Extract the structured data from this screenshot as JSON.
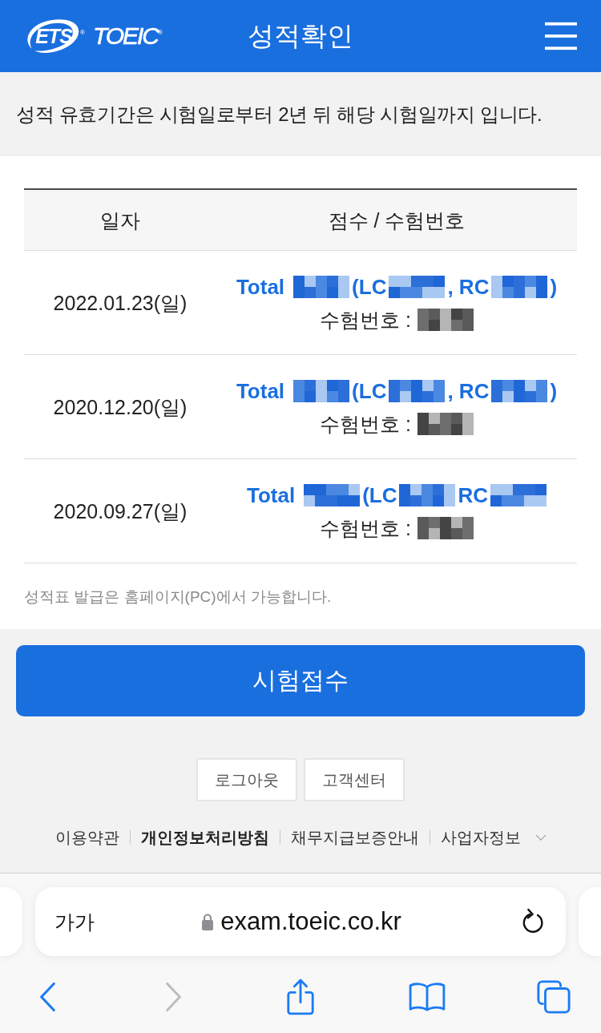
{
  "header": {
    "logo": {
      "ets": "ETS",
      "ets_mark": "®",
      "wordmark": "TOEIC",
      "wordmark_mark": "®"
    },
    "title": "성적확인"
  },
  "notice": "성적 유효기간은 시험일로부터 2년 뒤 해당 시험일까지 입니다.",
  "table": {
    "columns": [
      "일자",
      "점수 / 수험번호"
    ],
    "rows": [
      {
        "date": "2022.01.23(일)",
        "score": [
          {
            "kind": "text",
            "text": "Total"
          },
          {
            "kind": "redacted"
          },
          {
            "kind": "text",
            "text": "(LC"
          },
          {
            "kind": "redacted"
          },
          {
            "kind": "text",
            "text": ", RC"
          },
          {
            "kind": "redacted"
          },
          {
            "kind": "text",
            "text": ")"
          }
        ],
        "exam_no_label": "수험번호 :"
      },
      {
        "date": "2020.12.20(일)",
        "score": [
          {
            "kind": "text",
            "text": "Total"
          },
          {
            "kind": "redacted"
          },
          {
            "kind": "text",
            "text": "(LC"
          },
          {
            "kind": "redacted"
          },
          {
            "kind": "text",
            "text": ", RC"
          },
          {
            "kind": "redacted"
          },
          {
            "kind": "text",
            "text": ")"
          }
        ],
        "exam_no_label": "수험번호 :"
      },
      {
        "date": "2020.09.27(일)",
        "score": [
          {
            "kind": "text",
            "text": "Total"
          },
          {
            "kind": "redacted"
          },
          {
            "kind": "text",
            "text": "(LC"
          },
          {
            "kind": "redacted"
          },
          {
            "kind": "text",
            "text": "RC"
          },
          {
            "kind": "redacted"
          }
        ],
        "exam_no_label": "수험번호 :"
      }
    ]
  },
  "issue_note": "성적표 발급은 홈페이지(PC)에서 가능합니다.",
  "apply_button": "시험접수",
  "footer": {
    "buttons": [
      "로그아웃",
      "고객센터"
    ],
    "links": [
      {
        "text": "이용약관",
        "bold": false,
        "dropdown": false
      },
      {
        "text": "개인정보처리방침",
        "bold": true,
        "dropdown": false
      },
      {
        "text": "채무지급보증안내",
        "bold": false,
        "dropdown": false
      },
      {
        "text": "사업자정보",
        "bold": false,
        "dropdown": true
      }
    ]
  },
  "browser": {
    "text_size": "가가",
    "secure": true,
    "url": "exam.toeic.co.kr",
    "toolbar": [
      {
        "kind": "back",
        "disabled": false
      },
      {
        "kind": "forward",
        "disabled": true
      },
      {
        "kind": "share",
        "disabled": false
      },
      {
        "kind": "bookmarks",
        "disabled": false
      },
      {
        "kind": "tabs",
        "disabled": false
      }
    ]
  }
}
